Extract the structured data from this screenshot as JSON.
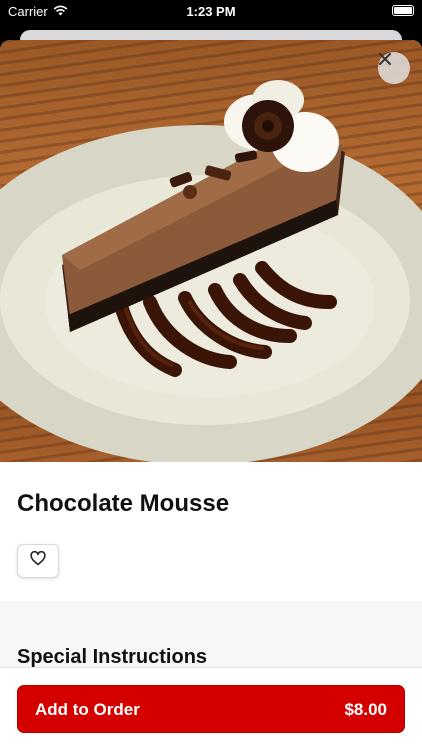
{
  "status_bar": {
    "carrier": "Carrier",
    "time": "1:23 PM"
  },
  "item": {
    "name": "Chocolate Mousse",
    "image_icon": "chocolate-mousse-photo"
  },
  "sections": {
    "special_instructions_heading": "Special Instructions"
  },
  "footer": {
    "add_label": "Add to Order",
    "price": "$8.00"
  },
  "colors": {
    "accent": "#d40000",
    "text": "#111111"
  },
  "icons": {
    "close": "close-icon",
    "favorite": "heart-icon",
    "wifi": "wifi-icon",
    "battery": "battery-icon"
  }
}
